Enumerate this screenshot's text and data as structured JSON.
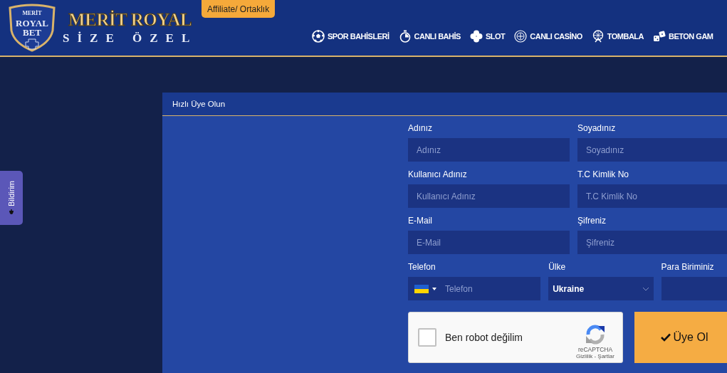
{
  "header": {
    "logo": {
      "badge_lines": [
        "MERİT",
        "ROYAL",
        "BET"
      ],
      "title": "MERİT ROYAL",
      "subtitle": "SİZE ÖZEL"
    },
    "affiliate_button": "Affiliate/ Ortaklık",
    "nav": [
      {
        "label": "SPOR BAHİSLERİ"
      },
      {
        "label": "CANLI BAHİS"
      },
      {
        "label": "SLOT"
      },
      {
        "label": "CANLI CASİNO"
      },
      {
        "label": "TOMBALA"
      },
      {
        "label": "BETON GAM"
      }
    ]
  },
  "side_tab": {
    "label": "Bildirim"
  },
  "form": {
    "title": "Hızlı Üye Olun",
    "fields": [
      {
        "label": "Adınız",
        "placeholder": "Adınız"
      },
      {
        "label": "Soyadınız",
        "placeholder": "Soyadınız"
      },
      {
        "label": "Kullanıcı Adınız",
        "placeholder": "Kullanıcı Adınız"
      },
      {
        "label": "T.C Kimlik No",
        "placeholder": "T.C Kimlik No"
      },
      {
        "label": "E-Mail",
        "placeholder": "E-Mail"
      },
      {
        "label": "Şifreniz",
        "placeholder": "Şifreniz"
      }
    ],
    "phone": {
      "label": "Telefon",
      "placeholder": "Telefon"
    },
    "country": {
      "label": "Ülke",
      "value": "Ukraine"
    },
    "currency": {
      "label": "Para Biriminiz"
    },
    "captcha": {
      "label": "Ben robot değilim",
      "checked": false,
      "brand": "reCAPTCHA",
      "links": "Gizlilik - Şartlar"
    },
    "submit": "Üye Ol"
  }
}
